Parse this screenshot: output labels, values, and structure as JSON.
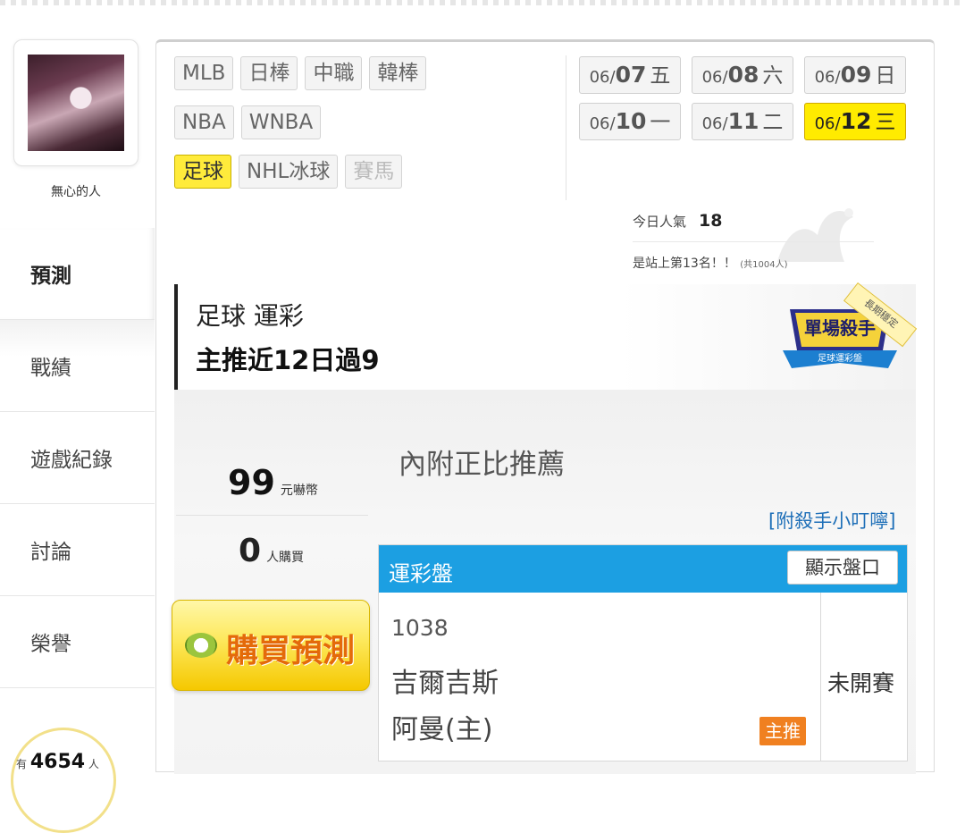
{
  "user": {
    "name": "無心的人"
  },
  "nav": {
    "items": [
      {
        "label": "預測"
      },
      {
        "label": "戰績"
      },
      {
        "label": "遊戲紀錄"
      },
      {
        "label": "討論"
      },
      {
        "label": "榮譽"
      }
    ]
  },
  "popularity_badge": {
    "prefix": "有",
    "count": "4654",
    "suffix": "人"
  },
  "categories": {
    "row1": [
      "MLB",
      "日棒",
      "中職",
      "韓棒"
    ],
    "row2": [
      "NBA",
      "WNBA"
    ],
    "row3": [
      "足球",
      "NHL冰球",
      "賽馬"
    ],
    "active": "足球",
    "disabled": "賽馬"
  },
  "dates": [
    {
      "md": "06/",
      "day": "07",
      "weekday": "五"
    },
    {
      "md": "06/",
      "day": "08",
      "weekday": "六"
    },
    {
      "md": "06/",
      "day": "09",
      "weekday": "日"
    },
    {
      "md": "06/",
      "day": "10",
      "weekday": "一"
    },
    {
      "md": "06/",
      "day": "11",
      "weekday": "二"
    },
    {
      "md": "06/",
      "day": "12",
      "weekday": "三",
      "active": true
    }
  ],
  "stats": {
    "today_label": "今日人氣",
    "today_value": "18",
    "rank_text": "是站上第13名！！",
    "rank_total": "(共1004人)"
  },
  "banner": {
    "line1": "足球 運彩",
    "line2": "主推近12日過9",
    "badge_title": "單場殺手",
    "badge_sub": "足球運彩盤",
    "ribbon": "長期穩定"
  },
  "price": {
    "amount": "99",
    "unit": "元嚇幣"
  },
  "buyers": {
    "count": "0",
    "unit": "人購買"
  },
  "buy_button": {
    "label": "購買預測"
  },
  "pick": {
    "title": "內附正比推薦",
    "tips_link": "[附殺手小叮嚀]"
  },
  "odds": {
    "header": "運彩盤",
    "show_button": "顯示盤口",
    "game_no": "1038",
    "team1": "吉爾吉斯",
    "team2": "阿曼(主)",
    "main_tag": "主推",
    "status": "未開賽"
  },
  "colors": {
    "accent_yellow": "#ffeb00",
    "header_blue": "#1c9fe2",
    "tag_orange": "#f08020",
    "link_blue": "#1e6fb8"
  }
}
